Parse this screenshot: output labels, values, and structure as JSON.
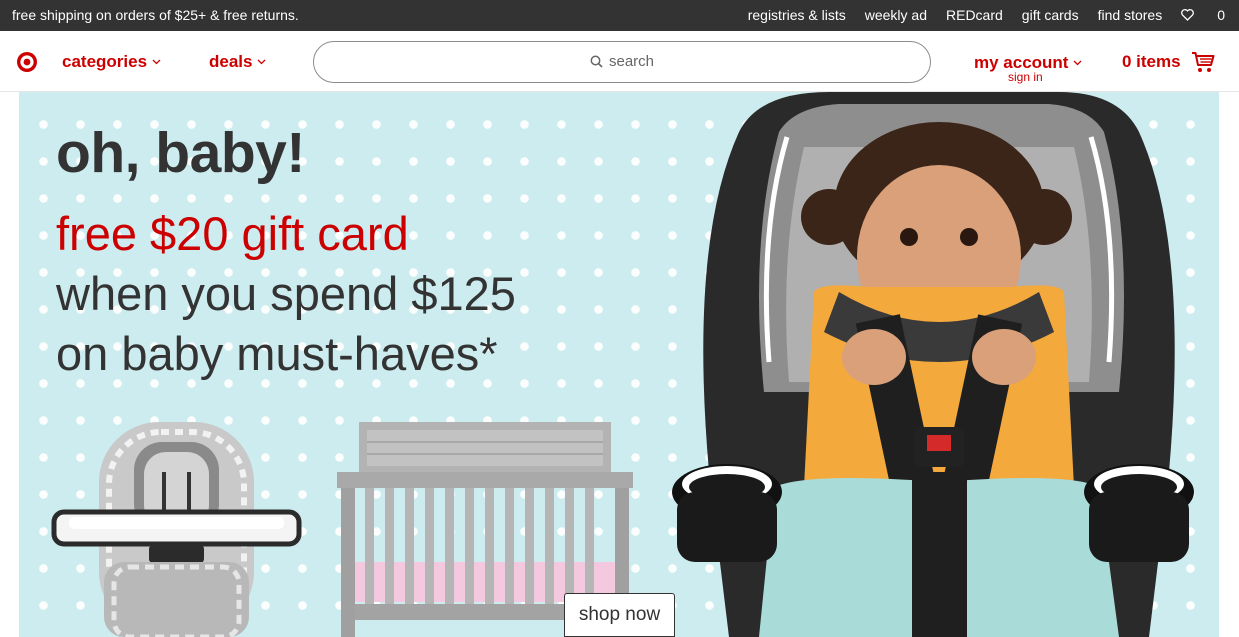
{
  "utility": {
    "promo": "free shipping on orders of $25+ & free returns.",
    "links": [
      "registries & lists",
      "weekly ad",
      "REDcard",
      "gift cards",
      "find stores"
    ],
    "favorites_count": "0"
  },
  "header": {
    "categories": "categories",
    "deals": "deals",
    "search_placeholder": "search",
    "account_label": "my account",
    "account_sub": "sign in",
    "cart_label": "0 items"
  },
  "hero": {
    "title": "oh, baby!",
    "offer": "free $20 gift card",
    "line1": "when you spend $125",
    "line2": "on baby must-haves*",
    "cta": "shop now"
  },
  "colors": {
    "brand_red": "#cc0000",
    "top_bar": "#333333",
    "hero_bg": "#cdecef"
  },
  "icons": [
    "target-logo-icon",
    "chevron-down-icon",
    "search-icon",
    "heart-icon",
    "cart-icon"
  ]
}
